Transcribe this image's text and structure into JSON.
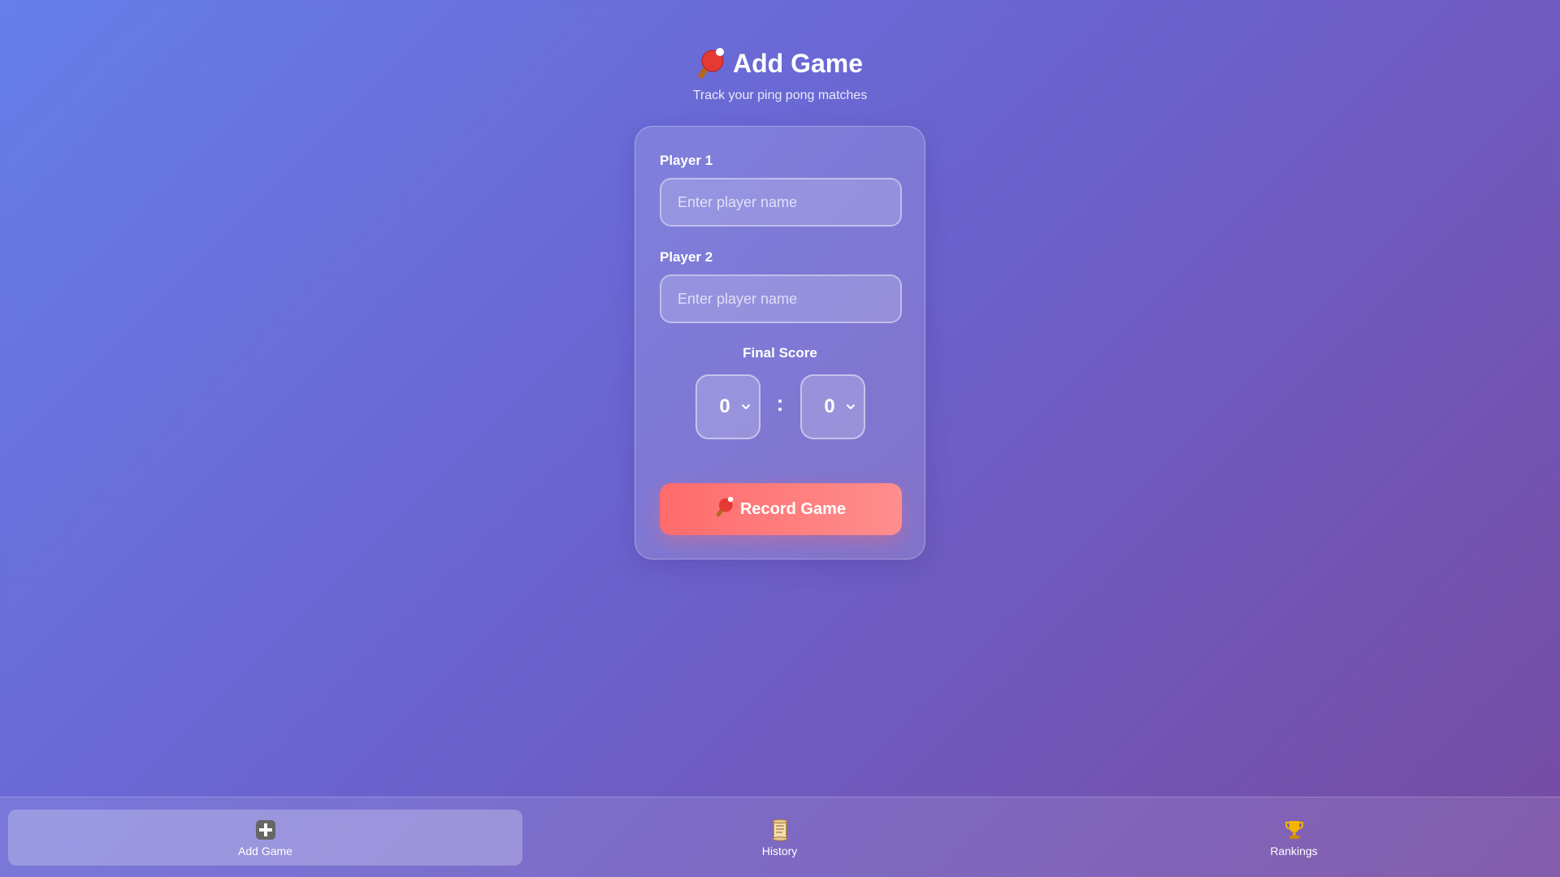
{
  "header": {
    "title": "Add Game",
    "subtitle": "Track your ping pong matches",
    "title_icon": "ping-pong-paddle-icon"
  },
  "form": {
    "player1": {
      "label": "Player 1",
      "placeholder": "Enter player name",
      "value": ""
    },
    "player2": {
      "label": "Player 2",
      "placeholder": "Enter player name",
      "value": ""
    },
    "score": {
      "label": "Final Score",
      "player1_value": "0",
      "player2_value": "0",
      "separator": ":"
    },
    "submit": {
      "label": "Record Game",
      "icon": "ping-pong-paddle-icon",
      "color_start": "#ff6b6b",
      "color_end": "#ff8e8e"
    }
  },
  "nav": {
    "items": [
      {
        "label": "Add Game",
        "icon": "plus-icon",
        "active": true
      },
      {
        "label": "History",
        "icon": "scroll-icon",
        "active": false
      },
      {
        "label": "Rankings",
        "icon": "trophy-icon",
        "active": false
      }
    ]
  },
  "colors": {
    "background_start": "#667eea",
    "background_end": "#764ba2"
  }
}
